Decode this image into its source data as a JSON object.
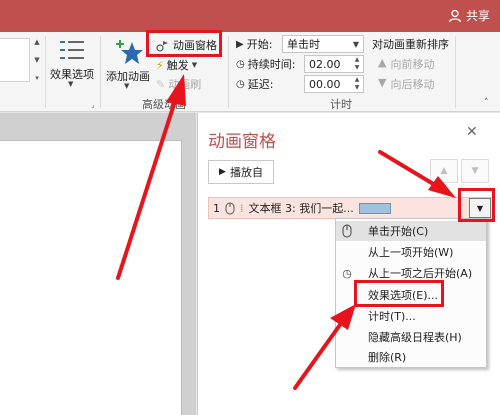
{
  "titlebar": {
    "share_label": "共享",
    "color": "#c0504d"
  },
  "ribbon": {
    "effect_options_label": "效果选项",
    "add_animation_label": "添加动画",
    "animation_pane_label": "动画窗格",
    "trigger_label": "触发",
    "animation_painter_label": "动画刷",
    "advanced_group_label": "高级动画",
    "start_label": "开始:",
    "start_value": "单击时",
    "duration_label": "持续时间:",
    "duration_value": "02.00",
    "delay_label": "延迟:",
    "delay_value": "00.00",
    "timing_group_label": "计时",
    "reorder_label": "对动画重新排序",
    "move_earlier_label": "向前移动",
    "move_later_label": "向后移动"
  },
  "pane": {
    "title": "动画窗格",
    "play_label": "播放自",
    "row_number": "1",
    "row_text": "文本框 3: 我们一起..."
  },
  "menu": {
    "items": [
      "单击开始(C)",
      "从上一项开始(W)",
      "从上一项之后开始(A)",
      "效果选项(E)...",
      "计时(T)...",
      "隐藏高级日程表(H)",
      "删除(R)"
    ]
  },
  "annotation_color": "#e8141c"
}
